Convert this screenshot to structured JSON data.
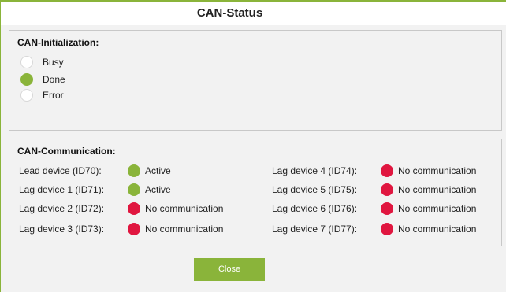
{
  "title": "CAN-Status",
  "init": {
    "heading": "CAN-Initialization:",
    "options": [
      {
        "label": "Busy",
        "state": "off"
      },
      {
        "label": "Done",
        "state": "on"
      },
      {
        "label": "Error",
        "state": "off"
      }
    ]
  },
  "comm": {
    "heading": "CAN-Communication:",
    "left": [
      {
        "device": "Lead device (ID70):",
        "status": "Active"
      },
      {
        "device": "Lag device 1 (ID71):",
        "status": "Active"
      },
      {
        "device": "Lag device 2 (ID72):",
        "status": "No communication"
      },
      {
        "device": "Lag device 3 (ID73):",
        "status": "No communication"
      }
    ],
    "right": [
      {
        "device": "Lag device 4 (ID74):",
        "status": "No communication"
      },
      {
        "device": "Lag device 5 (ID75):",
        "status": "No communication"
      },
      {
        "device": "Lag device 6 (ID76):",
        "status": "No communication"
      },
      {
        "device": "Lag device 7 (ID77):",
        "status": "No communication"
      }
    ]
  },
  "buttons": {
    "close": "Close"
  },
  "colors": {
    "active": "#8ab43a",
    "no_communication": "#e0163f",
    "accent": "#8ab43a"
  }
}
